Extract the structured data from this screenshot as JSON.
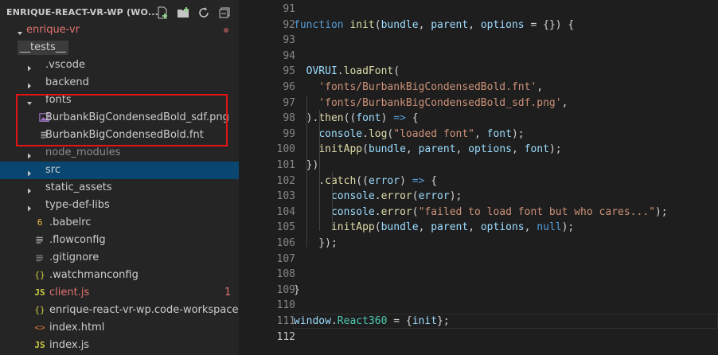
{
  "explorer": {
    "title": "ENRIQUE-REACT-VR-WP (WO...",
    "actions": [
      "new-file-icon",
      "new-folder-icon",
      "refresh-icon",
      "collapse-all-icon"
    ]
  },
  "tree": [
    {
      "label": "enrique-vr",
      "type": "folder-open",
      "color": "#e0736d",
      "badge_dot": true
    },
    {
      "label": "__tests__",
      "type": "folder"
    },
    {
      "label": ".vscode",
      "type": "folder"
    },
    {
      "label": "backend",
      "type": "folder"
    },
    {
      "label": "fonts",
      "type": "folder-open"
    },
    {
      "label": "BurbankBigCondensedBold_sdf.png",
      "type": "image-file"
    },
    {
      "label": "BurbankBigCondensedBold.fnt",
      "type": "text-file"
    },
    {
      "label": "node_modules",
      "type": "folder",
      "color": "#8c8c8c"
    },
    {
      "label": "src",
      "type": "folder",
      "selected": true
    },
    {
      "label": "static_assets",
      "type": "folder"
    },
    {
      "label": "type-def-libs",
      "type": "folder"
    },
    {
      "label": ".babelrc",
      "type": "babel-file",
      "icon_text": "6"
    },
    {
      "label": ".flowconfig",
      "type": "text-file"
    },
    {
      "label": ".gitignore",
      "type": "git-file"
    },
    {
      "label": ".watchmanconfig",
      "type": "json-file",
      "icon_text": "{}"
    },
    {
      "label": "client.js",
      "type": "js-file",
      "icon_text": "JS",
      "color": "#e0736d",
      "badge": "1"
    },
    {
      "label": "enrique-react-vr-wp.code-workspace",
      "type": "json-file",
      "icon_text": "{}"
    },
    {
      "label": "index.html",
      "type": "html-file",
      "icon_text": "<>"
    },
    {
      "label": "index.js",
      "type": "js-file",
      "icon_text": "JS"
    }
  ],
  "editor": {
    "lines": [
      {
        "n": "91",
        "tokens": []
      },
      {
        "n": "92",
        "tokens": [
          [
            "kw",
            "function"
          ],
          [
            "pun",
            " "
          ],
          [
            "fn",
            "init"
          ],
          [
            "pun",
            "("
          ],
          [
            "var",
            "bundle"
          ],
          [
            "pun",
            ", "
          ],
          [
            "var",
            "parent"
          ],
          [
            "pun",
            ", "
          ],
          [
            "var",
            "options"
          ],
          [
            "pun",
            " = {}) {"
          ]
        ]
      },
      {
        "n": "93",
        "tokens": []
      },
      {
        "n": "94",
        "tokens": []
      },
      {
        "n": "95",
        "tokens": [
          [
            "pun",
            "  "
          ],
          [
            "var",
            "OVRUI"
          ],
          [
            "pun",
            "."
          ],
          [
            "fn",
            "loadFont"
          ],
          [
            "pun",
            "("
          ]
        ]
      },
      {
        "n": "96",
        "tokens": [
          [
            "pun",
            "    "
          ],
          [
            "str",
            "'fonts/BurbankBigCondensedBold.fnt'"
          ],
          [
            "pun",
            ","
          ]
        ]
      },
      {
        "n": "97",
        "tokens": [
          [
            "pun",
            "    "
          ],
          [
            "str",
            "'fonts/BurbankBigCondensedBold_sdf.png'"
          ],
          [
            "pun",
            ","
          ]
        ]
      },
      {
        "n": "98",
        "tokens": [
          [
            "pun",
            "  )."
          ],
          [
            "fn",
            "then"
          ],
          [
            "pun",
            "(("
          ],
          [
            "var",
            "font"
          ],
          [
            "pun",
            ") "
          ],
          [
            "kw",
            "=>"
          ],
          [
            "pun",
            " {"
          ]
        ]
      },
      {
        "n": "99",
        "tokens": [
          [
            "pun",
            "    "
          ],
          [
            "var",
            "console"
          ],
          [
            "pun",
            "."
          ],
          [
            "fn",
            "log"
          ],
          [
            "pun",
            "("
          ],
          [
            "str",
            "\"loaded font\""
          ],
          [
            "pun",
            ", "
          ],
          [
            "var",
            "font"
          ],
          [
            "pun",
            ");"
          ]
        ]
      },
      {
        "n": "100",
        "tokens": [
          [
            "pun",
            "    "
          ],
          [
            "fn",
            "initApp"
          ],
          [
            "pun",
            "("
          ],
          [
            "var",
            "bundle"
          ],
          [
            "pun",
            ", "
          ],
          [
            "var",
            "parent"
          ],
          [
            "pun",
            ", "
          ],
          [
            "var",
            "options"
          ],
          [
            "pun",
            ", "
          ],
          [
            "var",
            "font"
          ],
          [
            "pun",
            ");"
          ]
        ]
      },
      {
        "n": "101",
        "tokens": [
          [
            "pun",
            "  })"
          ]
        ]
      },
      {
        "n": "102",
        "tokens": [
          [
            "pun",
            "    ."
          ],
          [
            "fn",
            "catch"
          ],
          [
            "pun",
            "(("
          ],
          [
            "var",
            "error"
          ],
          [
            "pun",
            ") "
          ],
          [
            "kw",
            "=>"
          ],
          [
            "pun",
            " {"
          ]
        ]
      },
      {
        "n": "103",
        "tokens": [
          [
            "pun",
            "      "
          ],
          [
            "var",
            "console"
          ],
          [
            "pun",
            "."
          ],
          [
            "fn",
            "error"
          ],
          [
            "pun",
            "("
          ],
          [
            "var",
            "error"
          ],
          [
            "pun",
            ");"
          ]
        ]
      },
      {
        "n": "104",
        "tokens": [
          [
            "pun",
            "      "
          ],
          [
            "var",
            "console"
          ],
          [
            "pun",
            "."
          ],
          [
            "fn",
            "error"
          ],
          [
            "pun",
            "("
          ],
          [
            "str",
            "\"failed to load font but who cares...\""
          ],
          [
            "pun",
            ");"
          ]
        ]
      },
      {
        "n": "105",
        "tokens": [
          [
            "pun",
            "      "
          ],
          [
            "fn",
            "initApp"
          ],
          [
            "pun",
            "("
          ],
          [
            "var",
            "bundle"
          ],
          [
            "pun",
            ", "
          ],
          [
            "var",
            "parent"
          ],
          [
            "pun",
            ", "
          ],
          [
            "var",
            "options"
          ],
          [
            "pun",
            ", "
          ],
          [
            "kw",
            "null"
          ],
          [
            "pun",
            ");"
          ]
        ]
      },
      {
        "n": "106",
        "tokens": [
          [
            "pun",
            "    });"
          ]
        ]
      },
      {
        "n": "107",
        "tokens": []
      },
      {
        "n": "108",
        "tokens": []
      },
      {
        "n": "109",
        "tokens": [
          [
            "pun",
            "}"
          ]
        ]
      },
      {
        "n": "110",
        "tokens": []
      },
      {
        "n": "111",
        "tokens": [
          [
            "var",
            "window"
          ],
          [
            "pun",
            "."
          ],
          [
            "cls",
            "React360"
          ],
          [
            "pun",
            " = {"
          ],
          [
            "var",
            "init"
          ],
          [
            "pun",
            "};"
          ]
        ]
      },
      {
        "n": "112",
        "tokens": [],
        "active": true
      }
    ]
  },
  "colors": {
    "selection": "#094771",
    "highlight_box": "#e51414",
    "error_text": "#e0736d"
  }
}
